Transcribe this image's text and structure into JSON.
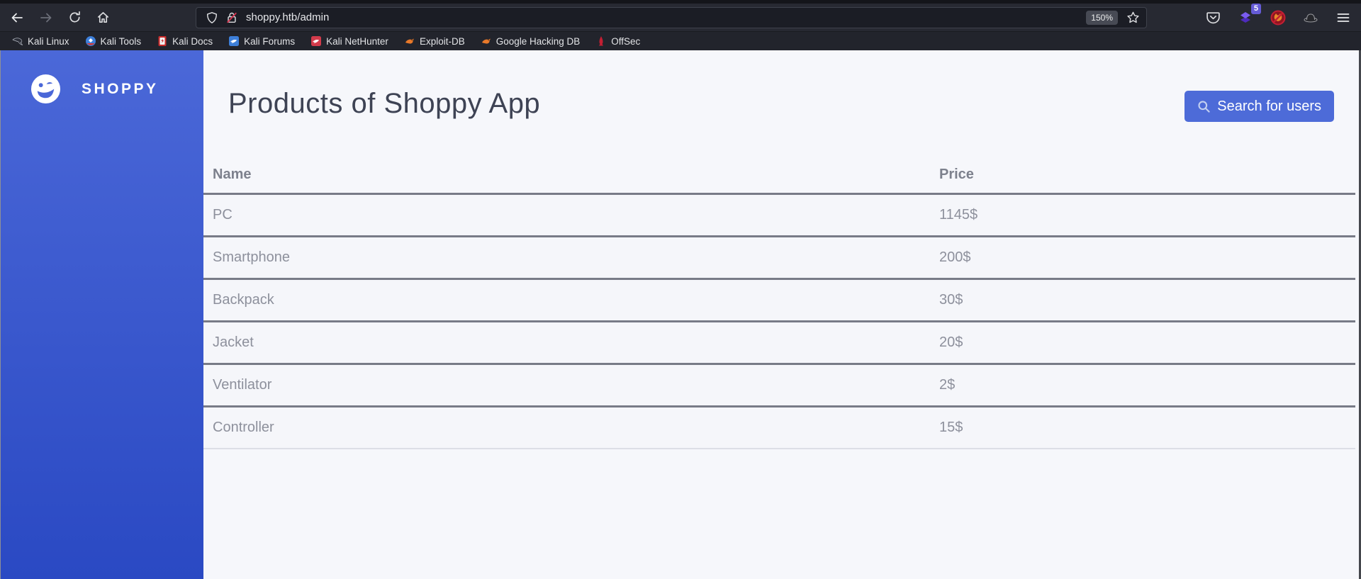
{
  "browser": {
    "url": "shoppy.htb/admin",
    "zoom_level": "150%",
    "extension_badge": "5",
    "bookmarks": [
      {
        "label": "Kali Linux"
      },
      {
        "label": "Kali Tools"
      },
      {
        "label": "Kali Docs"
      },
      {
        "label": "Kali Forums"
      },
      {
        "label": "Kali NetHunter"
      },
      {
        "label": "Exploit-DB"
      },
      {
        "label": "Google Hacking DB"
      },
      {
        "label": "OffSec"
      }
    ]
  },
  "sidebar": {
    "brand": "SHOPPY"
  },
  "main": {
    "title": "Products of Shoppy App",
    "search_button": "Search for users",
    "table": {
      "headers": [
        "Name",
        "Price"
      ],
      "rows": [
        [
          "PC",
          "1145$"
        ],
        [
          "Smartphone",
          "200$"
        ],
        [
          "Backpack",
          "30$"
        ],
        [
          "Jacket",
          "20$"
        ],
        [
          "Ventilator",
          "2$"
        ],
        [
          "Controller",
          "15$"
        ]
      ]
    }
  },
  "colors": {
    "accent_blue": "#4d6bd8",
    "sidebar_gradient_top": "#4b68d8",
    "sidebar_gradient_bottom": "#2a49c3",
    "chrome_dark": "#272932",
    "content_bg": "#f6f7fb",
    "table_border": "#787b87",
    "insecure_slash_red": "#d7324e"
  }
}
